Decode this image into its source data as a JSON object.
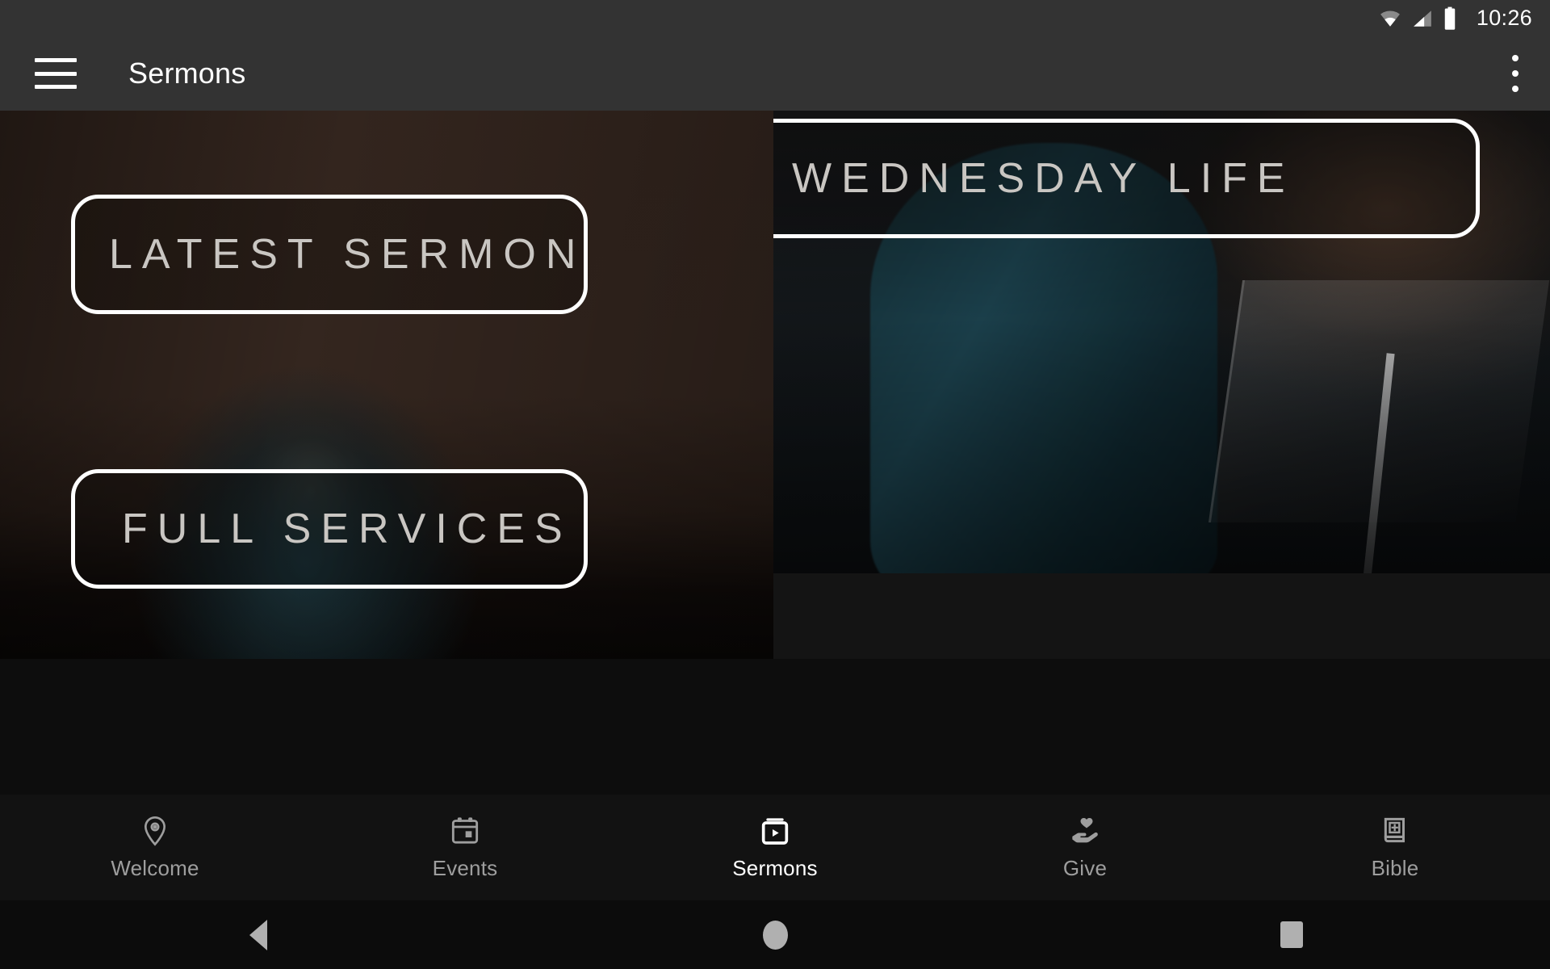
{
  "status_bar": {
    "time": "10:26",
    "icons": [
      "wifi-icon",
      "cellular-signal-icon",
      "battery-icon"
    ]
  },
  "toolbar": {
    "menu_icon": "hamburger-menu-icon",
    "title": "Sermons",
    "overflow_icon": "overflow-menu-icon"
  },
  "tiles": [
    {
      "id": "latest-sermon",
      "label": "LATEST SERMON"
    },
    {
      "id": "wednesday-life",
      "label": "WEDNESDAY LIFE"
    },
    {
      "id": "full-services",
      "label": "FULL SERVICES"
    }
  ],
  "bottom_nav": {
    "items": [
      {
        "label": "Welcome",
        "icon": "location-pin-icon",
        "active": false
      },
      {
        "label": "Events",
        "icon": "calendar-icon",
        "active": false
      },
      {
        "label": "Sermons",
        "icon": "video-library-icon",
        "active": true
      },
      {
        "label": "Give",
        "icon": "hand-heart-icon",
        "active": false
      },
      {
        "label": "Bible",
        "icon": "bible-book-icon",
        "active": false
      }
    ]
  },
  "system_nav": {
    "back": "back-triangle-icon",
    "home": "home-circle-icon",
    "recents": "recents-square-icon"
  },
  "colors": {
    "toolbar_bg": "#333333",
    "nav_bg": "#121212",
    "sysnav_bg": "#0c0c0c",
    "tile_border": "#ffffff",
    "tile_text": "#c9c6c2",
    "active_label": "#ffffff",
    "inactive_label": "#9e9e9e"
  }
}
